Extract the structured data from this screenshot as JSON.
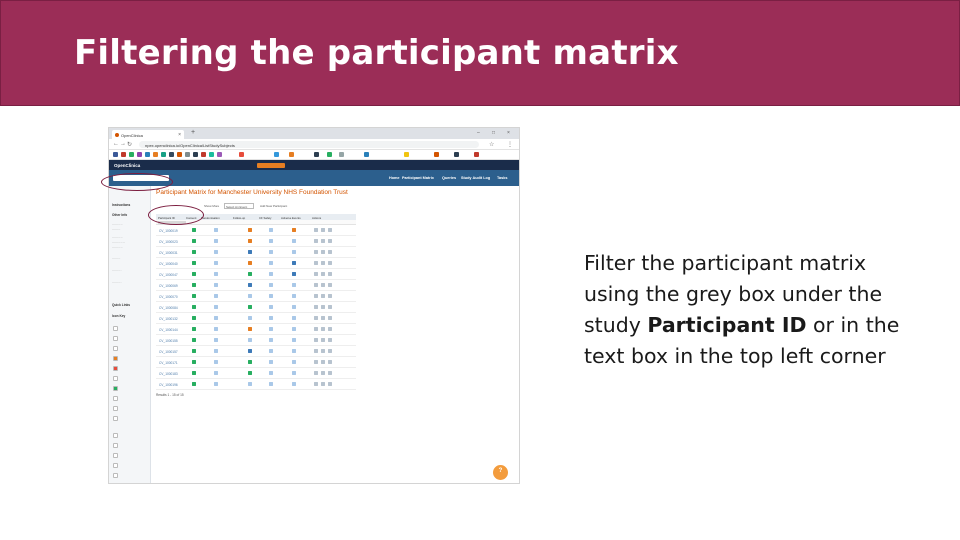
{
  "slide": {
    "title": "Filtering the participant matrix",
    "caption_line1": "Filter the participant matrix",
    "caption_line2": "using the grey box under the",
    "caption_line3_pre": "study ",
    "caption_line3_bold": "Participant ID",
    "caption_line3_post": " or in the",
    "caption_line4": "text box in the top left corner",
    "colors": {
      "title_bar": "#9b2d57",
      "annotation_ring": "#7b1d3f"
    }
  },
  "browser": {
    "tab_label": "OpenClinica",
    "url": "npex.openclinica.io/OpenClinica/ListStudySubjects"
  },
  "openclinica": {
    "logo": "OpenClinica",
    "page_title": "Participant Matrix for Manchester University NHS Foundation Trust",
    "menu": [
      "Home",
      "Participant Matrix",
      "Queries",
      "Study Audit Log",
      "Tasks"
    ],
    "sidebar_instructions": "Instructions",
    "sidebar_info": "Other Info",
    "sidebar_links": "Quick Links",
    "sidebar_iconkey": "Icon Key",
    "results_text": "Results 1 - 15 of 15",
    "toolbar": {
      "show_more": "Show More",
      "select_event": "Select An Event",
      "add_participant": "Add New Participant"
    },
    "table_headers": [
      "Participant ID",
      "Consent",
      "Randomisation",
      "Follow-up",
      "CF Safety",
      "Adverse Events",
      "Actions"
    ]
  }
}
